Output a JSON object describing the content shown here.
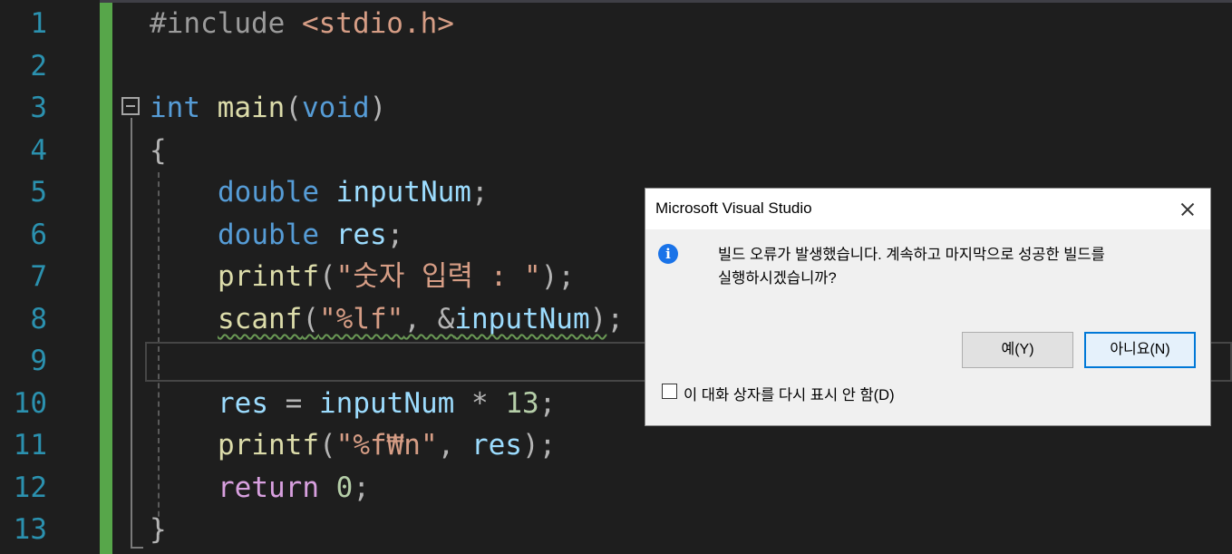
{
  "editor": {
    "line_numbers": [
      "1",
      "2",
      "3",
      "4",
      "5",
      "6",
      "7",
      "8",
      "9",
      "10",
      "11",
      "12",
      "13"
    ],
    "lines": [
      [
        "#include ",
        "<stdio.h>"
      ],
      [],
      [
        "int",
        " ",
        "main",
        "(",
        "void",
        ")"
      ],
      [
        "{"
      ],
      [
        "double",
        " ",
        "inputNum",
        ";"
      ],
      [
        "double",
        " ",
        "res",
        ";"
      ],
      [
        "printf",
        "(",
        "\"숫자 입력 : \"",
        ");"
      ],
      [
        "scanf",
        "(",
        "\"%lf\"",
        ", &",
        "inputNum",
        ")",
        ";"
      ],
      [],
      [
        "res",
        " = ",
        "inputNum",
        " * ",
        "13",
        ";"
      ],
      [
        "printf",
        "(",
        "\"%f₩n\"",
        ", ",
        "res",
        ");"
      ],
      [
        "return",
        " ",
        "0",
        ";"
      ],
      [
        "}"
      ]
    ],
    "colors": {
      "background": "#1e1e1e",
      "line_number": "#2b91af",
      "keyword": "#569cd6",
      "function": "#dcdcaa",
      "variable": "#9cdcfe",
      "string": "#d69d85",
      "number": "#b5cea8",
      "control": "#d8a0df",
      "change_bar": "#57a64a"
    }
  },
  "dialog": {
    "title": "Microsoft Visual Studio",
    "icon": "info-icon",
    "message_line1": "빌드 오류가 발생했습니다. 계속하고 마지막으로 성공한 빌드를",
    "message_line2": "실행하시겠습니까?",
    "yes_label": "예(Y)",
    "no_label": "아니요(N)",
    "checkbox_label": "이 대화 상자를 다시 표시 안 함(D)",
    "checkbox_checked": false
  }
}
